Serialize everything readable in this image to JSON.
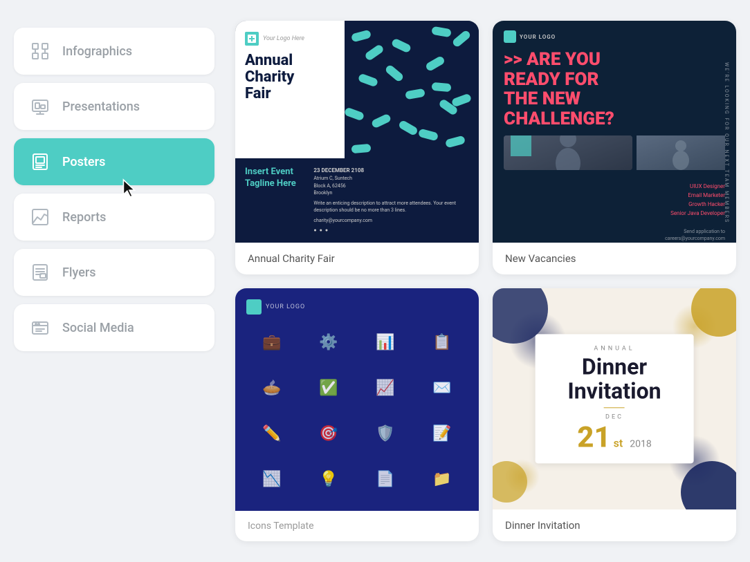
{
  "sidebar": {
    "items": [
      {
        "id": "infographics",
        "label": "Infographics",
        "icon": "infographics-icon"
      },
      {
        "id": "presentations",
        "label": "Presentations",
        "icon": "presentations-icon"
      },
      {
        "id": "posters",
        "label": "Posters",
        "icon": "posters-icon",
        "active": true
      },
      {
        "id": "reports",
        "label": "Reports",
        "icon": "reports-icon"
      },
      {
        "id": "flyers",
        "label": "Flyers",
        "icon": "flyers-icon"
      },
      {
        "id": "social-media",
        "label": "Social Media",
        "icon": "social-media-icon"
      }
    ]
  },
  "cards": [
    {
      "id": "annual-charity-fair",
      "label": "Annual Charity Fair",
      "tagline": "Insert Event Tagline Here",
      "date": "23 DECEMBER 2108",
      "venue": "Atrium C, Suntech",
      "address": "Block A, 62456",
      "city": "Brooklyn",
      "description": "Write an enticing description to attract more attendees. Your event description should be no more than 3 lines.",
      "email": "charity@yourcompany.com",
      "logo_text": "Your Logo Here",
      "title_line1": "Annual",
      "title_line2": "Charity",
      "title_line3": "Fair"
    },
    {
      "id": "new-vacancies",
      "label": "New Vacancies",
      "headline": ">> ARE YOU READY FOR THE NEW CHALLENGE?",
      "side_text": "WE'RE LOOKING FOR OUR NEXT TEAM MEMBERS",
      "roles": [
        "UIUX Designer",
        "Email Marketer",
        "Growth Hacker",
        "Senior Java Developer"
      ],
      "cta": "Send application to",
      "email": "careers@yourcompany.com",
      "logo_text": "YOUR LOGO"
    },
    {
      "id": "icons-template",
      "label": "Icons Template",
      "logo_text": "YOUR LOGO"
    },
    {
      "id": "dinner-invitation",
      "label": "Dinner Invitation",
      "annual_text": "ANNUAL",
      "title_line1": "Dinner",
      "title_line2": "Invitation",
      "dec_text": "DEC",
      "day": "21",
      "sup": "st",
      "year": "2018"
    }
  ],
  "accent_color": "#4ecdc4",
  "sidebar_active_color": "#4ecdc4"
}
